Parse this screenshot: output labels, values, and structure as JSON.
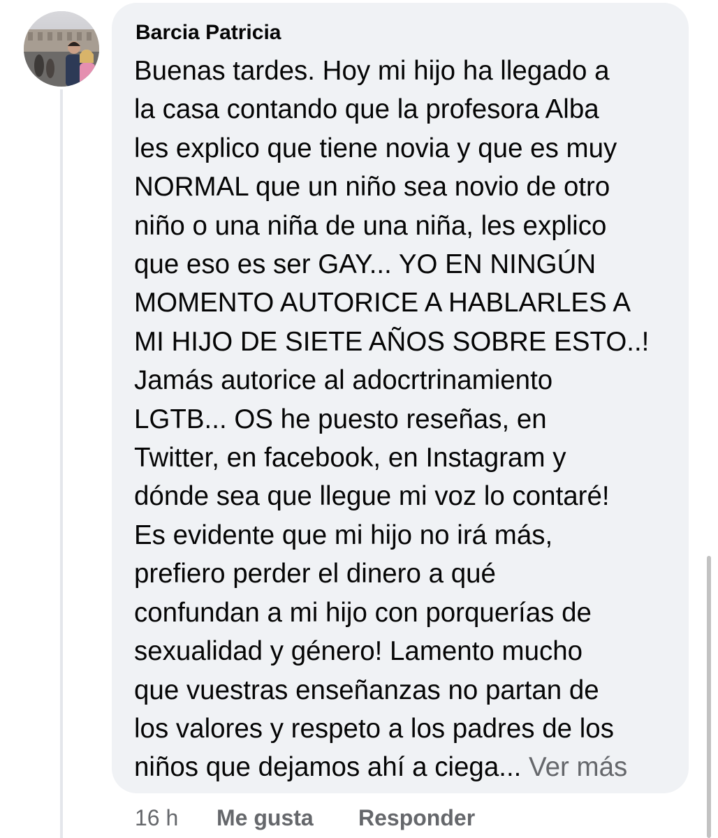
{
  "comment": {
    "author": "Barcia Patricia",
    "avatar": "profile-photo",
    "lines": [
      "Buenas tardes. Hoy mi hijo ha llegado a",
      "la casa contando que la profesora Alba",
      "les explico que tiene novia y que es muy",
      "NORMAL que un niño sea novio de otro",
      "niño o una niña de una niña, les explico",
      "que eso es ser GAY... YO EN NINGÚN",
      "MOMENTO AUTORICE A HABLARLES A",
      "MI HIJO DE SIETE AÑOS SOBRE ESTO..!",
      "Jamás autorice al adocrtrinamiento",
      "LGTB... OS he puesto reseñas, en",
      "Twitter, en facebook, en Instagram y",
      "dónde sea que llegue mi voz lo contaré!",
      "Es evidente que mi hijo no irá más,",
      "prefiero perder el dinero a qué",
      "confundan a mi hijo con porquerías de",
      "sexualidad y género! Lamento mucho",
      "que vuestras enseñanzas no partan de",
      "los valores y respeto a los padres de los",
      "niños que dejamos ahí a ciega..."
    ],
    "see_more": "Ver más"
  },
  "actions": {
    "time": "16 h",
    "like": "Me gusta",
    "reply": "Responder"
  },
  "colors": {
    "bubble": "#f0f2f5",
    "text": "#050505",
    "muted": "#65676b",
    "thread_line": "#e4e6eb"
  }
}
